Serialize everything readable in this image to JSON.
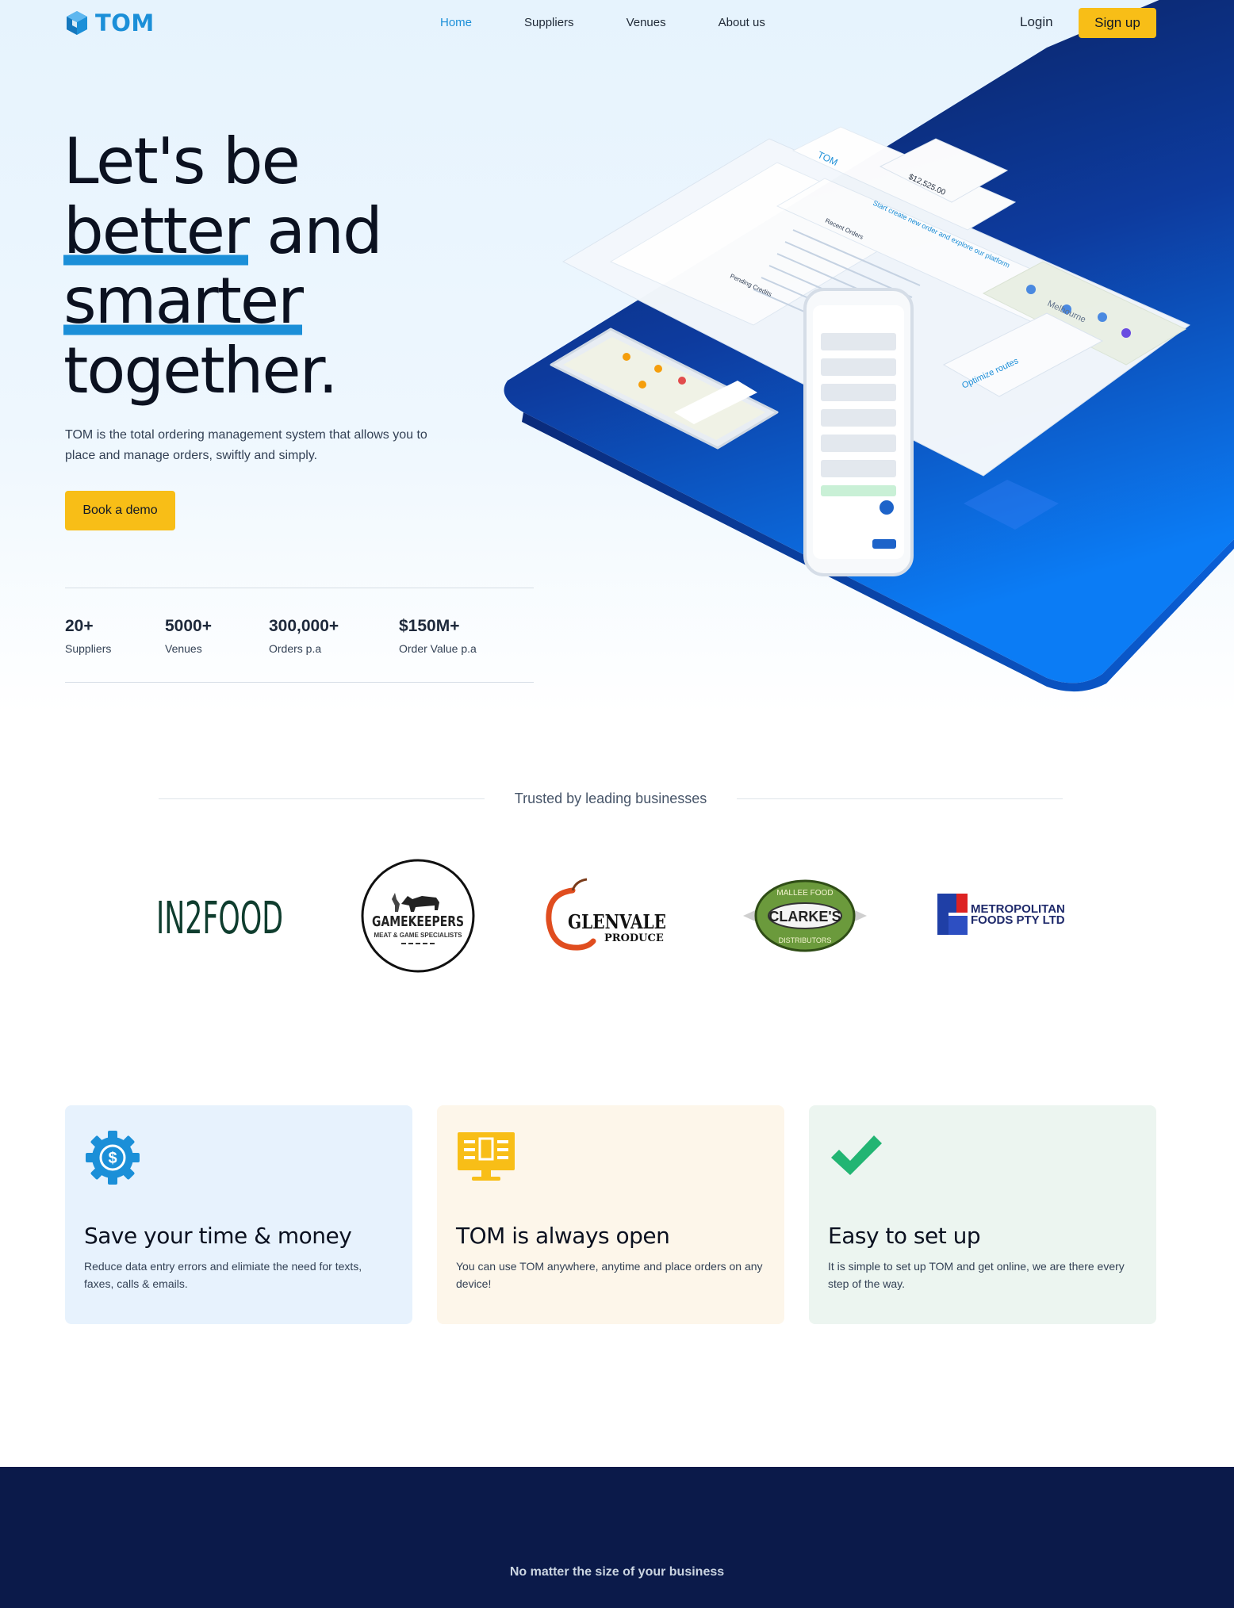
{
  "nav": {
    "logo_text": "TOM",
    "links": [
      "Home",
      "Suppliers",
      "Venues",
      "About us"
    ],
    "login_label": "Login",
    "signup_label": "Sign up",
    "active_color": "#1b8fd8"
  },
  "hero": {
    "headline_lines": [
      "Let's be",
      "better",
      "and",
      "smarter",
      "together."
    ],
    "subtext": "TOM is the total ordering management system that allows you to place and manage orders, swiftly and simply.",
    "cta_label": "Book a demo",
    "art": {
      "optimize_label": "Optimize routes",
      "map_label": "Melbourne",
      "recent_orders_label": "Recent Orders",
      "pending_label": "Pending Credits",
      "amount_label": "$12,525.00",
      "promo_label": "Start create new order and explore our platform"
    }
  },
  "stats": [
    {
      "value": "20+",
      "label": "Suppliers"
    },
    {
      "value": "5000+",
      "label": "Venues"
    },
    {
      "value": "300,000+",
      "label": "Orders p.a"
    },
    {
      "value": "$150M+",
      "label": "Order Value p.a"
    }
  ],
  "trusted": {
    "heading": "Trusted by leading businesses",
    "logos": {
      "in2food": "IN2FOOD",
      "gamekeepers_title": "GAMEKEEPERS",
      "gamekeepers_sub": "MEAT & GAME SPECIALISTS",
      "glenvale_title": "GLENVALE",
      "glenvale_sub": "PRODUCE",
      "clarkes_top": "MALLEE FOOD",
      "clarkes_name": "CLARKE'S",
      "clarkes_bottom": "DISTRIBUTORS",
      "metro_line1": "METROPOLITAN",
      "metro_line2": "FOODS PTY LTD"
    }
  },
  "features": [
    {
      "title": "Save your time & money",
      "text": "Reduce data entry errors and elimiate the need for texts, faxes, calls & emails.",
      "icon": "gear-dollar-icon",
      "bg": "#e7f2fd"
    },
    {
      "title": "TOM is always open",
      "text": "You can use TOM anywhere, anytime and place orders on any device!",
      "icon": "monitor-icon",
      "bg": "#fdf6ea"
    },
    {
      "title": "Easy to set up",
      "text": "It is simple to set up TOM and get online, we are there every step of the way.",
      "icon": "checkmark-icon",
      "bg": "#ecf5f0"
    }
  ],
  "band": {
    "text": "No matter the size of your business"
  },
  "colors": {
    "accent_blue": "#1b8fd8",
    "cta_yellow": "#f8be17",
    "navy": "#0b1a4a"
  }
}
